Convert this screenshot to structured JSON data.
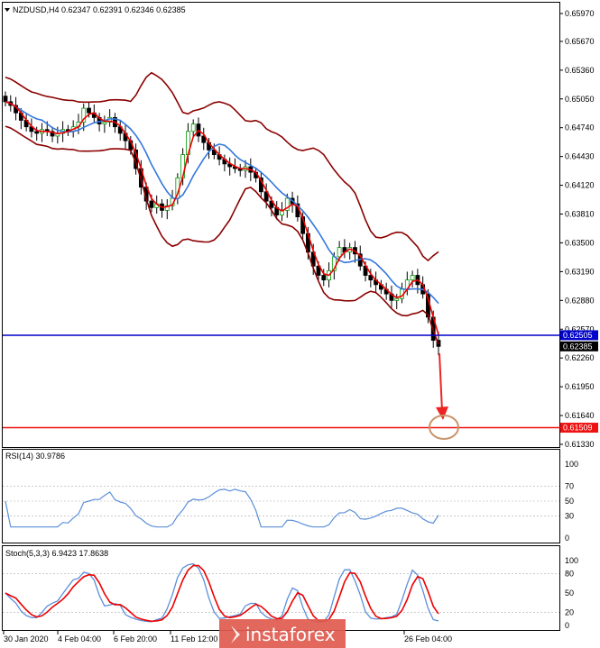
{
  "header": {
    "text": "NZDUSD,H4  0.62347 0.62391 0.62346 0.62385"
  },
  "price_axis": [
    "0.65970",
    "0.65670",
    "0.65360",
    "0.65050",
    "0.64740",
    "0.64430",
    "0.64120",
    "0.63810",
    "0.63500",
    "0.63190",
    "0.62880",
    "0.62570",
    "0.62260",
    "0.61950",
    "0.61640",
    "0.61330"
  ],
  "price_tags": {
    "blue": "0.62505",
    "current": "0.62385",
    "red": "0.61509"
  },
  "rsi": {
    "title": "RSI(14) 30.9786",
    "levels": [
      "100",
      "70",
      "50",
      "30",
      "0"
    ]
  },
  "stoch": {
    "title": "Stoch(5,3,3) 6.9423 17.8638",
    "levels": [
      "100",
      "80",
      "50",
      "20",
      "0"
    ]
  },
  "time_axis": [
    "30 Jan 2020",
    "4 Feb 04:00",
    "6 Feb 20:00",
    "11 Feb 12:00",
    "26 Feb 04:00"
  ],
  "watermark": "instaforex",
  "colors": {
    "blue_level": "#0000cc",
    "red_level": "#ee1111",
    "ma_fast": "#ee0000",
    "ma_slow": "#3377dd",
    "bollinger": "#8b0000",
    "candle_up": "#009900",
    "candle_down": "#cc0000",
    "osc_line": "#5b8fd9",
    "stoch_signal": "#ee0000"
  },
  "chart_data": {
    "type": "candlestick",
    "symbol": "NZDUSD",
    "timeframe": "H4",
    "ohlc_last": {
      "open": 0.62347,
      "high": 0.62391,
      "low": 0.62346,
      "close": 0.62385
    },
    "ylim": [
      0.613,
      0.6605
    ],
    "levels": {
      "support_blue": 0.62505,
      "target_red": 0.61509,
      "current": 0.62385
    },
    "close_series": [
      0.6502,
      0.6498,
      0.649,
      0.6482,
      0.6475,
      0.647,
      0.6468,
      0.6472,
      0.647,
      0.6465,
      0.6468,
      0.6472,
      0.647,
      0.6475,
      0.648,
      0.6495,
      0.649,
      0.6485,
      0.6478,
      0.648,
      0.6485,
      0.6475,
      0.6468,
      0.646,
      0.645,
      0.643,
      0.641,
      0.6395,
      0.6388,
      0.6392,
      0.6385,
      0.639,
      0.6398,
      0.642,
      0.6445,
      0.647,
      0.6478,
      0.6465,
      0.6458,
      0.645,
      0.6445,
      0.644,
      0.6435,
      0.6432,
      0.643,
      0.6428,
      0.6432,
      0.6426,
      0.642,
      0.6405,
      0.6395,
      0.6388,
      0.638,
      0.6385,
      0.6398,
      0.6392,
      0.6378,
      0.636,
      0.634,
      0.6325,
      0.6315,
      0.631,
      0.632,
      0.6335,
      0.6345,
      0.634,
      0.6345,
      0.6338,
      0.6325,
      0.6315,
      0.631,
      0.6305,
      0.63,
      0.6295,
      0.6288,
      0.629,
      0.63,
      0.631,
      0.6315,
      0.6305,
      0.6295,
      0.627,
      0.6245,
      0.62385
    ],
    "rsi_value": 30.9786,
    "stoch_values": {
      "main": 6.9423,
      "signal": 17.8638
    }
  }
}
